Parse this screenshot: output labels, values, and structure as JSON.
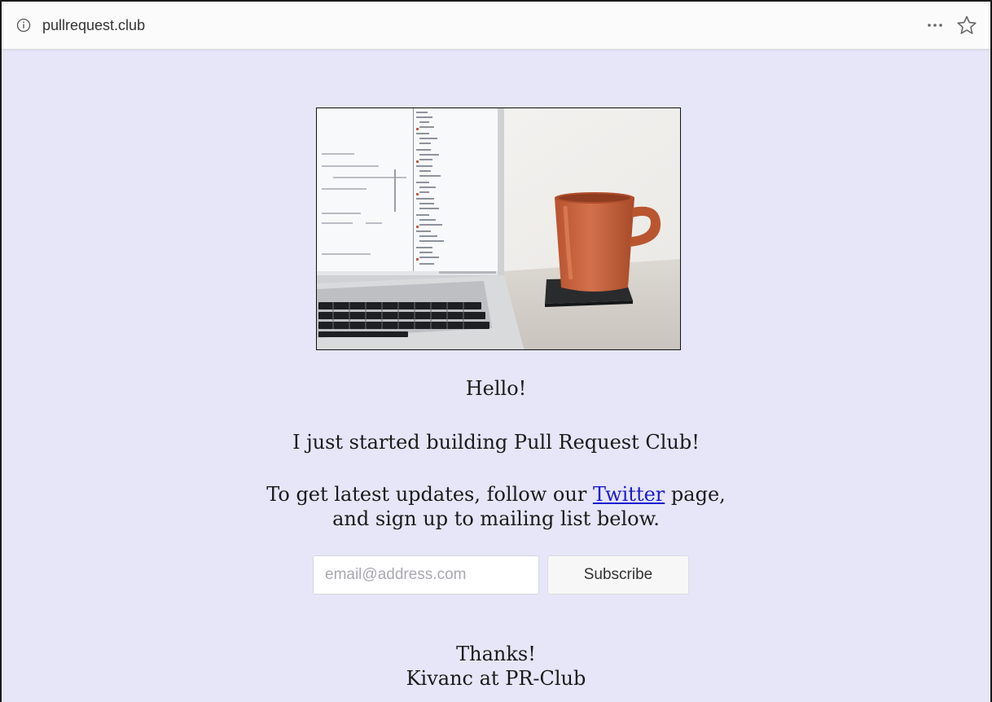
{
  "browser": {
    "url": "pullrequest.club",
    "icons": {
      "info": "info-circle-icon",
      "more": "more-horizontal-icon",
      "bookmark": "star-outline-icon"
    }
  },
  "page": {
    "image_alt": "Laptop with code editor and orange coffee mug",
    "greeting": "Hello!",
    "intro": "I just started building Pull Request Club!",
    "updates_prefix": "To get latest updates, follow our ",
    "twitter_link": "Twitter",
    "updates_suffix_line1": " page,",
    "updates_line2": "and sign up to mailing list below.",
    "email_placeholder": "email@address.com",
    "subscribe_label": "Subscribe",
    "thanks": "Thanks!",
    "signature": "Kivanc at PR-Club"
  },
  "colors": {
    "page_background": "#e6e6f8",
    "link": "#1a1ad1",
    "mug": "#c8623f"
  }
}
